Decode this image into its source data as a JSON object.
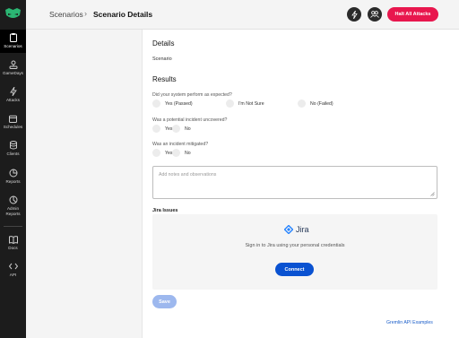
{
  "sidebar": {
    "items": [
      {
        "label": "Scenarios",
        "icon": "clipboard-icon"
      },
      {
        "label": "GameDays",
        "icon": "joystick-icon"
      },
      {
        "label": "Attacks",
        "icon": "lightning-icon"
      },
      {
        "label": "Schedules",
        "icon": "calendar-icon"
      },
      {
        "label": "Clients",
        "icon": "database-icon"
      },
      {
        "label": "Reports",
        "icon": "pie-chart-icon"
      },
      {
        "label": "Admin Reports",
        "icon": "admin-pie-icon"
      },
      {
        "label": "Docs",
        "icon": "book-icon"
      },
      {
        "label": "API",
        "icon": "code-icon"
      }
    ]
  },
  "header": {
    "breadcrumb_root": "Scenarios",
    "breadcrumb_sep": "›",
    "breadcrumb_current": "Scenario Details",
    "halt_label": "Halt All Attacks"
  },
  "main": {
    "details_heading": "Details",
    "scenario_text": "Scenario",
    "results_heading": "Results",
    "q1": {
      "question": "Did your system perform as expected?",
      "options": [
        "Yes (Passed)",
        "I'm Not Sure",
        "No (Failed)"
      ]
    },
    "q2": {
      "question": "Was a potential incident uncovered?",
      "options": [
        "Yes",
        "No"
      ]
    },
    "q3": {
      "question": "Was an incident mitigated?",
      "options": [
        "Yes",
        "No"
      ]
    },
    "notes_placeholder": "Add notes and observations",
    "jira": {
      "title": "Jira Issues",
      "logo_text": "Jira",
      "sign_in_text": "Sign in to Jira using your personal credentials",
      "connect_label": "Connect"
    },
    "save_label": "Save",
    "footer_link": "Gremlin API Examples"
  },
  "colors": {
    "sidebar_bg": "#1c1c1c",
    "halt_button": "#e8174e",
    "connect_button": "#0a52d1",
    "save_button_disabled": "#9db8ee",
    "link": "#1b5ec9",
    "logo_green": "#2bb673"
  }
}
